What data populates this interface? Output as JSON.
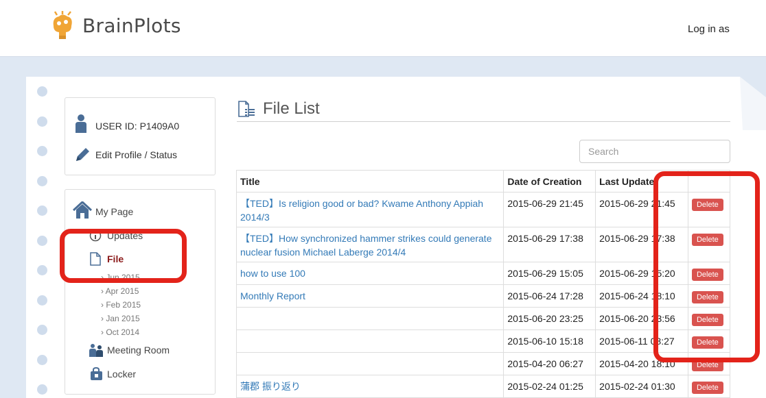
{
  "header": {
    "logo_text": "BrainPlots",
    "login_label": "Log in as"
  },
  "sidebar": {
    "user_id": "USER ID: P1409A0",
    "edit_profile": "Edit Profile / Status",
    "nav": {
      "my_page": "My Page",
      "updates": "Updates",
      "file": "File",
      "file_months": [
        "› Jun 2015",
        "› Apr 2015",
        "› Feb 2015",
        "› Jan 2015",
        "› Oct 2014"
      ],
      "meeting_room": "Meeting Room",
      "locker": "Locker"
    }
  },
  "main": {
    "title": "File List",
    "search_placeholder": "Search",
    "table": {
      "headers": [
        "Title",
        "Date of Creation",
        "Last Update",
        ""
      ],
      "rows": [
        {
          "title": "【TED】Is religion good or bad? Kwame Anthony Appiah 2014/3",
          "created": "2015-06-29 21:45",
          "updated": "2015-06-29 21:45",
          "action": "Delete"
        },
        {
          "title": "【TED】How synchronized hammer strikes could generate nuclear fusion Michael Laberge 2014/4",
          "created": "2015-06-29 17:38",
          "updated": "2015-06-29 17:38",
          "action": "Delete"
        },
        {
          "title": "how to use 100",
          "created": "2015-06-29 15:05",
          "updated": "2015-06-29 15:20",
          "action": "Delete"
        },
        {
          "title": "Monthly Report",
          "created": "2015-06-24 17:28",
          "updated": "2015-06-24 18:10",
          "action": "Delete"
        },
        {
          "title": "",
          "created": "2015-06-20 23:25",
          "updated": "2015-06-20 23:56",
          "action": "Delete"
        },
        {
          "title": "",
          "created": "2015-06-10 15:18",
          "updated": "2015-06-11 08:27",
          "action": "Delete"
        },
        {
          "title": "",
          "created": "2015-04-20 06:27",
          "updated": "2015-04-20 18:10",
          "action": "Delete"
        },
        {
          "title": "蒲郡 振り返り",
          "created": "2015-02-24 01:25",
          "updated": "2015-02-24 01:30",
          "action": "Delete"
        }
      ]
    }
  },
  "colors": {
    "accent_blue": "#337ab7",
    "delete_red": "#d9534f",
    "highlight_red": "#e3231a",
    "active_nav": "#8b1a1a",
    "page_background": "#dfe8f3"
  }
}
